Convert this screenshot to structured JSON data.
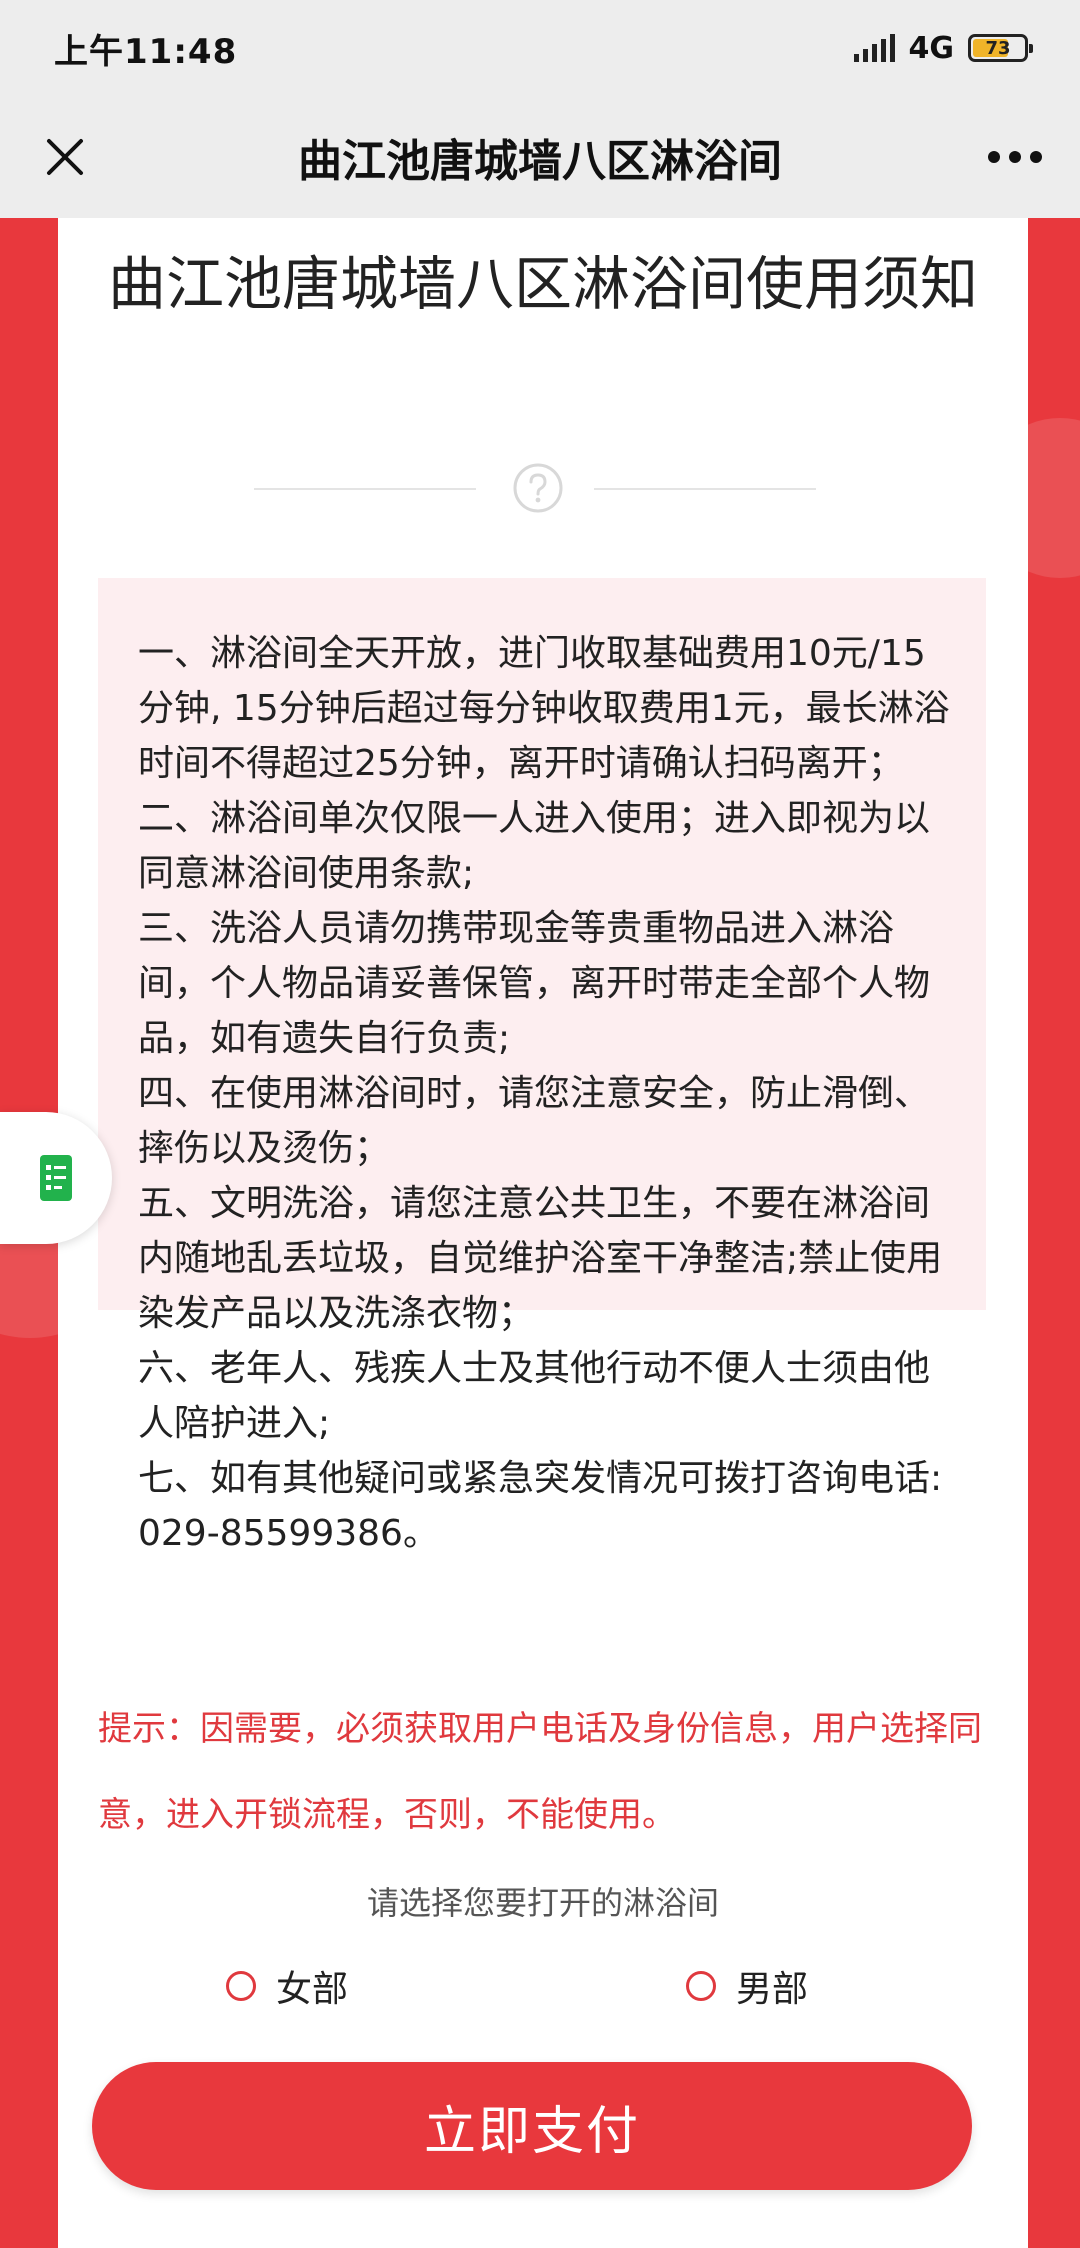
{
  "status_bar": {
    "time": "上午11:48",
    "network": "4G",
    "battery": "73",
    "battery_level": 0.73
  },
  "nav": {
    "title": "曲江池唐城墙八区淋浴间",
    "close_icon": "close-icon",
    "more_icon": "more-icon"
  },
  "page": {
    "title": "曲江池唐城墙八区淋浴间使用须知",
    "help_icon": "question-circle-icon"
  },
  "rules": [
    "一、淋浴间全天开放，进门收取基础费用10元/15分钟, 15分钟后超过每分钟收取费用1元，最长淋浴时间不得超过25分钟，离开时请确认扫码离开；",
    "二、淋浴间单次仅限一人进入使用；进入即视为以同意淋浴间使用条款;",
    "三、洗浴人员请勿携带现金等贵重物品进入淋浴间，个人物品请妥善保管，离开时带走全部个人物品，如有遗失自行负责;",
    "四、在使用淋浴间时，请您注意安全，防止滑倒、摔伤以及烫伤；",
    "五、文明洗浴，请您注意公共卫生，不要在淋浴间内随地乱丢垃圾，自觉维护浴室干净整洁;禁止使用染发产品以及洗涤衣物；",
    "六、老年人、残疾人士及其他行动不便人士须由他人陪护进入;",
    "七、如有其他疑问或紧急突发情况可拨打咨询电话:029-85599386。"
  ],
  "notice": "提示：因需要，必须获取用户电话及身份信息，用户选择同意，进入开锁流程，否则，不能使用。",
  "selection": {
    "prompt": "请选择您要打开的淋浴间",
    "options": [
      "女部",
      "男部"
    ]
  },
  "pay_button": "立即支付",
  "side_tab_icon": "document-icon",
  "colors": {
    "brand_red": "#e8383d",
    "rules_bg": "#fdeef0",
    "notice_text": "#e0393e"
  }
}
